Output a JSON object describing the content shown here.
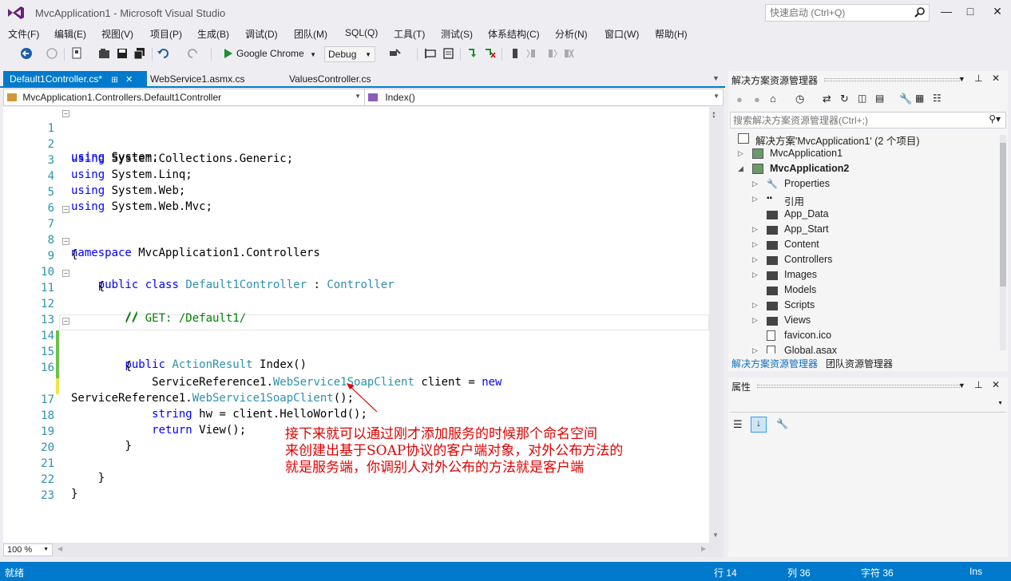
{
  "window": {
    "title": "MvcApplication1 - Microsoft Visual Studio",
    "quick_launch_placeholder": "快速启动 (Ctrl+Q)"
  },
  "menu": [
    "文件(F)",
    "编辑(E)",
    "视图(V)",
    "项目(P)",
    "生成(B)",
    "调试(D)",
    "团队(M)",
    "SQL(Q)",
    "工具(T)",
    "测试(S)",
    "体系结构(C)",
    "分析(N)",
    "窗口(W)",
    "帮助(H)"
  ],
  "toolbar": {
    "run_target": "Google Chrome",
    "configuration": "Debug"
  },
  "doc_tabs": [
    {
      "label": "Default1Controller.cs*",
      "active": true
    },
    {
      "label": "WebService1.asmx.cs",
      "active": false
    },
    {
      "label": "ValuesController.cs",
      "active": false
    }
  ],
  "navbar": {
    "class_scope": "MvcApplication1.Controllers.Default1Controller",
    "member_scope": "Index()"
  },
  "code": {
    "line_numbers": [
      "1",
      "2",
      "3",
      "4",
      "5",
      "6",
      "7",
      "8",
      "9",
      "10",
      "11",
      "12",
      "13",
      "14",
      "15",
      "16",
      "",
      "17",
      "18",
      "19",
      "20",
      "21",
      "22",
      "23"
    ],
    "l1": {
      "kw": "using",
      "rest": " System;"
    },
    "l2": {
      "kw": "using",
      "rest": " System.Collections.Generic;"
    },
    "l3": {
      "kw": "using",
      "rest": " System.Linq;"
    },
    "l4": {
      "kw": "using",
      "rest": " System.Web;"
    },
    "l5": {
      "kw": "using",
      "rest": " System.Web.Mvc;"
    },
    "l7": {
      "kw": "namespace",
      "rest": " MvcApplication1.Controllers"
    },
    "l8": "{",
    "l9": {
      "kw1": "public",
      "kw2": "class",
      "type1": "Default1Controller",
      "sep": " : ",
      "type2": "Controller"
    },
    "l10": "{",
    "l11": "//",
    "l12": "// GET: /Default1/",
    "l14": {
      "kw": "public",
      "type": "ActionResult",
      "rest": " Index()"
    },
    "l15": "{",
    "l16": {
      "ns": "ServiceReference1.",
      "type": "WebService1SoapClient",
      "rest": " client = ",
      "kw": "new"
    },
    "l16b": {
      "ns": "ServiceReference1.",
      "type": "WebService1SoapClient",
      "rest": "();"
    },
    "l17": {
      "kw": "string",
      "rest": " hw = client.HelloWorld();"
    },
    "l18": {
      "kw": "return",
      "rest": " View();"
    },
    "l19": "}",
    "l21": "}",
    "l22": "}"
  },
  "annotation": [
    "接下来就可以通过刚才添加服务的时候那个命名空间",
    "来创建出基于SOAP协议的客户端对象，对外公布方法的",
    "就是服务端，你调别人对外公布的方法就是客户端"
  ],
  "zoom": "100 %",
  "solution_explorer": {
    "title": "解决方案资源管理器",
    "search_placeholder": "搜索解决方案资源管理器(Ctrl+;)",
    "solution": "解决方案'MvcApplication1' (2 个项目)",
    "items": [
      {
        "label": "MvcApplication1",
        "bold": false
      },
      {
        "label": "MvcApplication2",
        "bold": true
      },
      {
        "label": "Properties"
      },
      {
        "label": "引用"
      },
      {
        "label": "App_Data"
      },
      {
        "label": "App_Start"
      },
      {
        "label": "Content"
      },
      {
        "label": "Controllers"
      },
      {
        "label": "Images"
      },
      {
        "label": "Models"
      },
      {
        "label": "Scripts"
      },
      {
        "label": "Views"
      },
      {
        "label": "favicon.ico"
      },
      {
        "label": "Global.asax"
      }
    ],
    "bottom_tabs": [
      "解决方案资源管理器",
      "团队资源管理器"
    ]
  },
  "properties": {
    "title": "属性"
  },
  "status": {
    "ready": "就绪",
    "row": "行 14",
    "col": "列 36",
    "char": "字符 36",
    "mode": "Ins"
  },
  "colors": {
    "accent": "#007acc",
    "keyword": "#0000ff",
    "type": "#2b91af",
    "comment": "#008000",
    "annotation": "#e00000"
  }
}
